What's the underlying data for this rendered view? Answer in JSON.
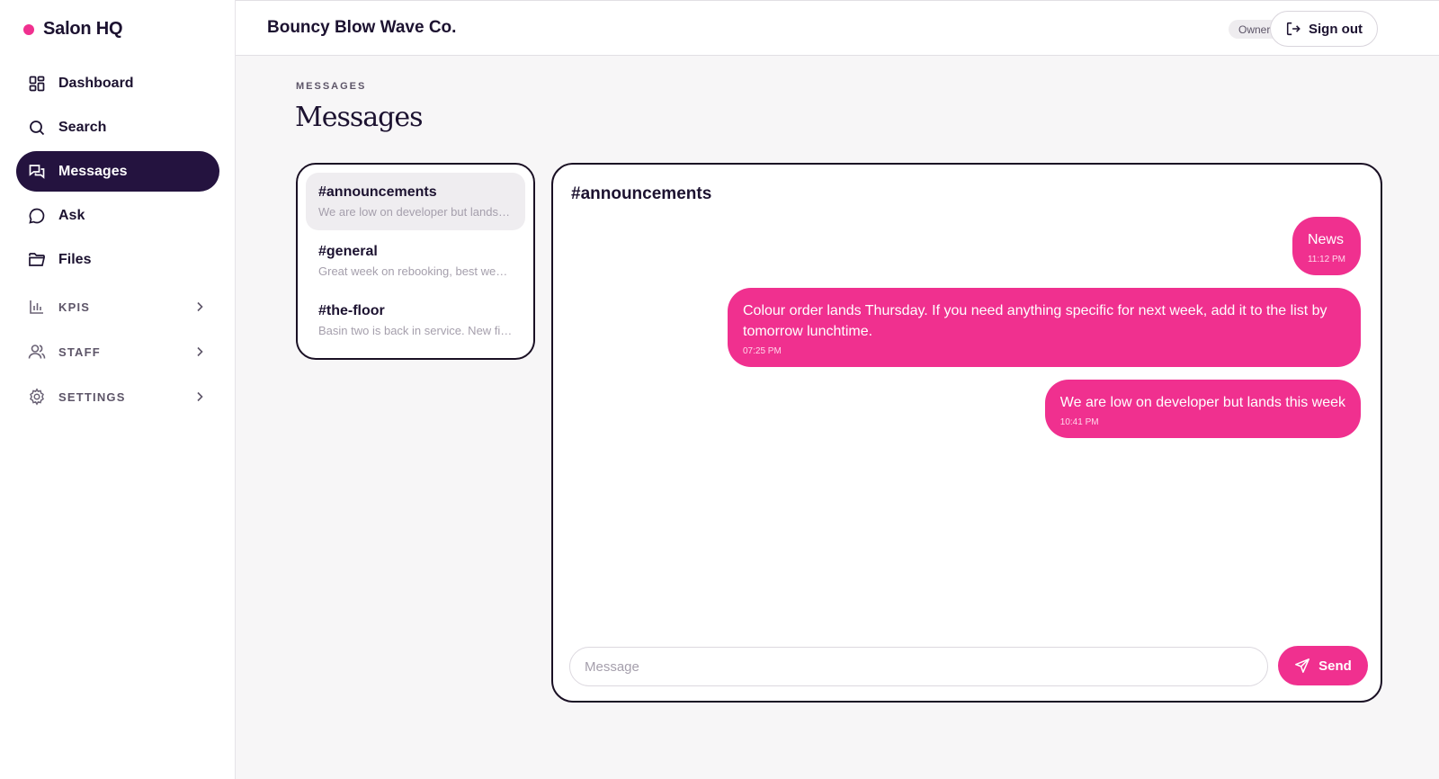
{
  "sidebar": {
    "brand": "Salon HQ",
    "items": [
      {
        "label": "Dashboard",
        "icon": "dashboard-grid-icon"
      },
      {
        "label": "Search",
        "icon": "search-icon"
      },
      {
        "label": "Messages",
        "icon": "chat-bubbles-icon",
        "active": true
      },
      {
        "label": "Ask",
        "icon": "chat-bubble-icon"
      },
      {
        "label": "Files",
        "icon": "folder-icon"
      }
    ],
    "groups": [
      {
        "label": "KPIS",
        "icon": "bar-chart-icon"
      },
      {
        "label": "STAFF",
        "icon": "users-icon"
      },
      {
        "label": "SETTINGS",
        "icon": "gear-icon"
      }
    ]
  },
  "header": {
    "org_name": "Bouncy Blow Wave Co.",
    "role": "Owner",
    "signout_label": "Sign out"
  },
  "page": {
    "eyebrow": "MESSAGES",
    "title": "Messages"
  },
  "channels": [
    {
      "name": "#announcements",
      "preview": "We are low on developer but lands this week",
      "active": true
    },
    {
      "name": "#general",
      "preview": "Great week on rebooking, best week yet",
      "active": false
    },
    {
      "name": "#the-floor",
      "preview": "Basin two is back in service. New filter fitted.",
      "active": false
    }
  ],
  "conversation": {
    "title": "#announcements",
    "messages": [
      {
        "text": "News",
        "time": "11:12 PM"
      },
      {
        "text": "Colour order lands Thursday. If you need anything specific for next week, add it to the list by tomorrow lunchtime.",
        "time": "07:25 PM"
      },
      {
        "text": "We are low on developer but lands this week",
        "time": "10:41 PM"
      }
    ],
    "composer_placeholder": "Message",
    "send_label": "Send"
  },
  "colors": {
    "accent": "#f0308f",
    "nav_active": "#24133f",
    "text": "#1c1230"
  }
}
